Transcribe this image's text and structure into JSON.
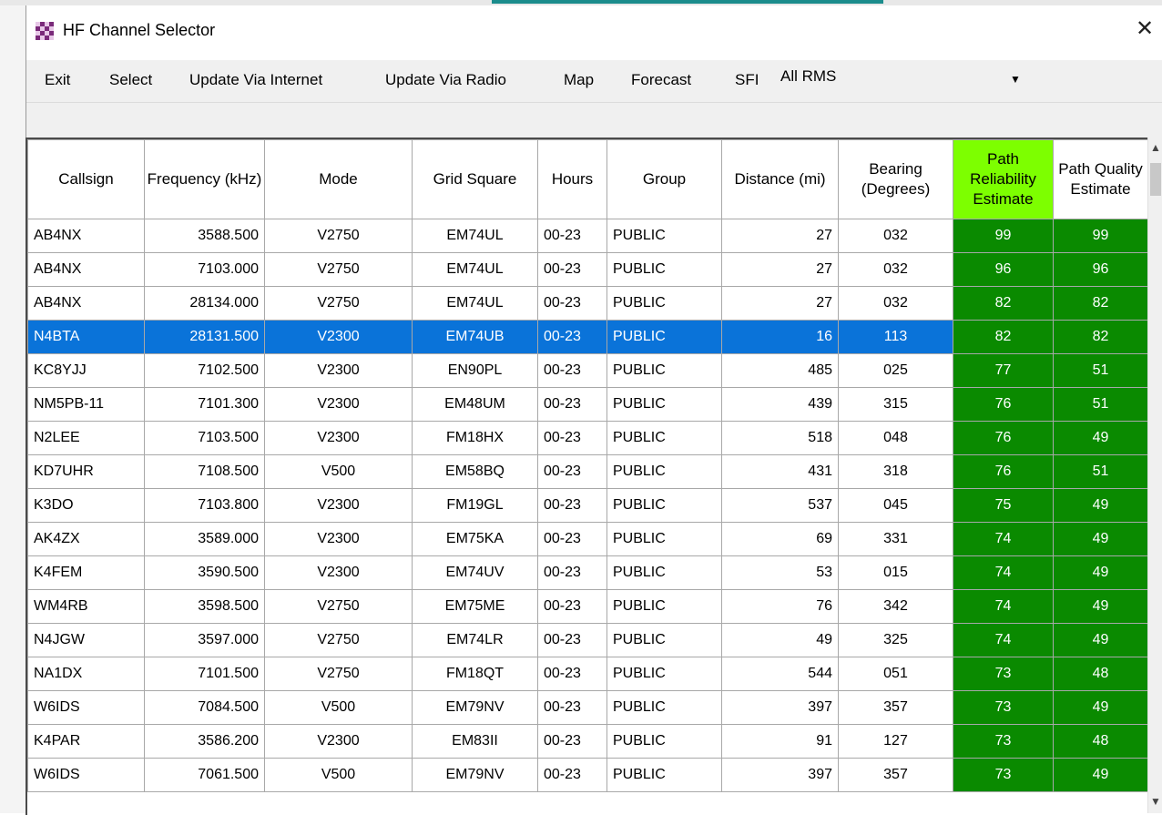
{
  "window": {
    "title": "HF Channel Selector",
    "close_glyph": "✕"
  },
  "menu": {
    "items": [
      "Exit",
      "Select",
      "Update Via Internet",
      "Update Via Radio",
      "Map",
      "Forecast",
      "SFI"
    ],
    "combo_value": "All RMS",
    "combo_arrow": "▼"
  },
  "colors": {
    "selected_row": "#0a73d9",
    "estimate_cell": "#0a8a00",
    "header_highlight": "#7dff00"
  },
  "table": {
    "headers": [
      "Callsign",
      "Frequency (kHz)",
      "Mode",
      "Grid Square",
      "Hours",
      "Group",
      "Distance (mi)",
      "Bearing (Degrees)",
      "Path Reliability Estimate",
      "Path Quality Estimate"
    ],
    "selected_index": 3,
    "rows": [
      [
        "AB4NX",
        "3588.500",
        "V2750",
        "EM74UL",
        "00-23",
        "PUBLIC",
        "27",
        "032",
        "99",
        "99"
      ],
      [
        "AB4NX",
        "7103.000",
        "V2750",
        "EM74UL",
        "00-23",
        "PUBLIC",
        "27",
        "032",
        "96",
        "96"
      ],
      [
        "AB4NX",
        "28134.000",
        "V2750",
        "EM74UL",
        "00-23",
        "PUBLIC",
        "27",
        "032",
        "82",
        "82"
      ],
      [
        "N4BTA",
        "28131.500",
        "V2300",
        "EM74UB",
        "00-23",
        "PUBLIC",
        "16",
        "113",
        "82",
        "82"
      ],
      [
        "KC8YJJ",
        "7102.500",
        "V2300",
        "EN90PL",
        "00-23",
        "PUBLIC",
        "485",
        "025",
        "77",
        "51"
      ],
      [
        "NM5PB-11",
        "7101.300",
        "V2300",
        "EM48UM",
        "00-23",
        "PUBLIC",
        "439",
        "315",
        "76",
        "51"
      ],
      [
        "N2LEE",
        "7103.500",
        "V2300",
        "FM18HX",
        "00-23",
        "PUBLIC",
        "518",
        "048",
        "76",
        "49"
      ],
      [
        "KD7UHR",
        "7108.500",
        "V500",
        "EM58BQ",
        "00-23",
        "PUBLIC",
        "431",
        "318",
        "76",
        "51"
      ],
      [
        "K3DO",
        "7103.800",
        "V2300",
        "FM19GL",
        "00-23",
        "PUBLIC",
        "537",
        "045",
        "75",
        "49"
      ],
      [
        "AK4ZX",
        "3589.000",
        "V2300",
        "EM75KA",
        "00-23",
        "PUBLIC",
        "69",
        "331",
        "74",
        "49"
      ],
      [
        "K4FEM",
        "3590.500",
        "V2300",
        "EM74UV",
        "00-23",
        "PUBLIC",
        "53",
        "015",
        "74",
        "49"
      ],
      [
        "WM4RB",
        "3598.500",
        "V2750",
        "EM75ME",
        "00-23",
        "PUBLIC",
        "76",
        "342",
        "74",
        "49"
      ],
      [
        "N4JGW",
        "3597.000",
        "V2750",
        "EM74LR",
        "00-23",
        "PUBLIC",
        "49",
        "325",
        "74",
        "49"
      ],
      [
        "NA1DX",
        "7101.500",
        "V2750",
        "FM18QT",
        "00-23",
        "PUBLIC",
        "544",
        "051",
        "73",
        "48"
      ],
      [
        "W6IDS",
        "7084.500",
        "V500",
        "EM79NV",
        "00-23",
        "PUBLIC",
        "397",
        "357",
        "73",
        "49"
      ],
      [
        "K4PAR",
        "3586.200",
        "V2300",
        "EM83II",
        "00-23",
        "PUBLIC",
        "91",
        "127",
        "73",
        "48"
      ],
      [
        "W6IDS",
        "7061.500",
        "V500",
        "EM79NV",
        "00-23",
        "PUBLIC",
        "397",
        "357",
        "73",
        "49"
      ]
    ]
  }
}
